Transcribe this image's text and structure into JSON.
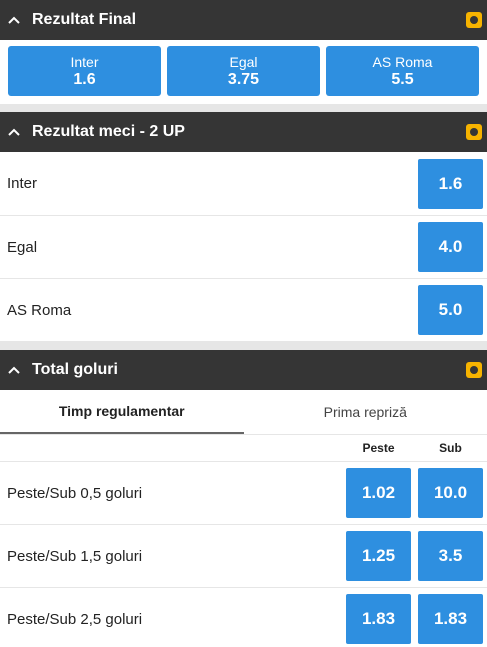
{
  "final_result": {
    "title": "Rezultat Final",
    "options": [
      {
        "name": "Inter",
        "odd": "1.6"
      },
      {
        "name": "Egal",
        "odd": "3.75"
      },
      {
        "name": "AS Roma",
        "odd": "5.5"
      }
    ]
  },
  "two_up": {
    "title": "Rezultat meci - 2 UP",
    "rows": [
      {
        "label": "Inter",
        "odd": "1.6"
      },
      {
        "label": "Egal",
        "odd": "4.0"
      },
      {
        "label": "AS Roma",
        "odd": "5.0"
      }
    ]
  },
  "total_goals": {
    "title": "Total goluri",
    "tabs": [
      {
        "label": "Timp regulamentar",
        "active": true
      },
      {
        "label": "Prima repriză",
        "active": false
      }
    ],
    "columns": [
      "Peste",
      "Sub"
    ],
    "rows": [
      {
        "label": "Peste/Sub 0,5 goluri",
        "over": "1.02",
        "under": "10.0"
      },
      {
        "label": "Peste/Sub 1,5 goluri",
        "over": "1.25",
        "under": "3.5"
      },
      {
        "label": "Peste/Sub 2,5 goluri",
        "over": "1.83",
        "under": "1.83"
      }
    ]
  },
  "colors": {
    "header_bg": "#353535",
    "accent_blue": "#2e8fe0",
    "badge_yellow": "#f6b300"
  },
  "icons": [
    "chevron-up-icon",
    "live-stats-icon"
  ]
}
